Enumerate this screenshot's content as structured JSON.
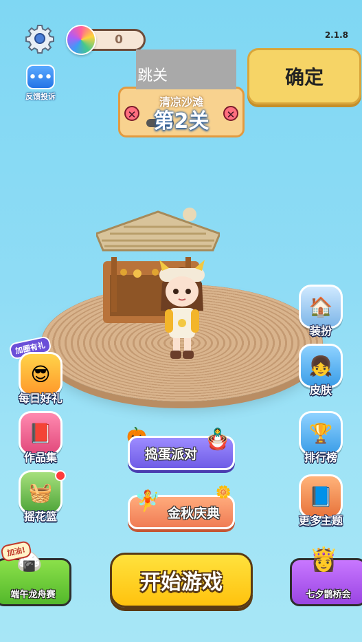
{
  "topbar": {
    "coins": "0",
    "version": "2.1.8",
    "icons": {
      "settings": "gear-icon",
      "currency": "yarn-ball-icon"
    }
  },
  "feedback": {
    "label": "反馈投诉"
  },
  "level": {
    "subtitle": "清凉沙滩",
    "title": "第2关"
  },
  "skip": {
    "value": "跳关"
  },
  "confirm": {
    "label": "确定"
  },
  "left_menu": {
    "daily": {
      "label": "每日好礼",
      "tag": "加圈有礼"
    },
    "works": {
      "label": "作品集"
    },
    "flower": {
      "label": "摇花篮"
    }
  },
  "right_menu": {
    "dressup": {
      "label": "装扮"
    },
    "skin": {
      "label": "皮肤"
    },
    "ranking": {
      "label": "排行榜"
    },
    "themes": {
      "label": "更多主题"
    }
  },
  "center": {
    "party": {
      "label": "捣蛋派对"
    },
    "autumn": {
      "label": "金秋庆典"
    },
    "start": {
      "label": "开始游戏"
    }
  },
  "corners": {
    "dragonboat": {
      "label": "端午龙舟赛",
      "tag": "加油!"
    },
    "qixi": {
      "label": "七夕鹊桥会"
    }
  },
  "colors": {
    "sky": "#8fdcf5",
    "start_button": "#ffd21f",
    "confirm_button": "#f6d466"
  }
}
